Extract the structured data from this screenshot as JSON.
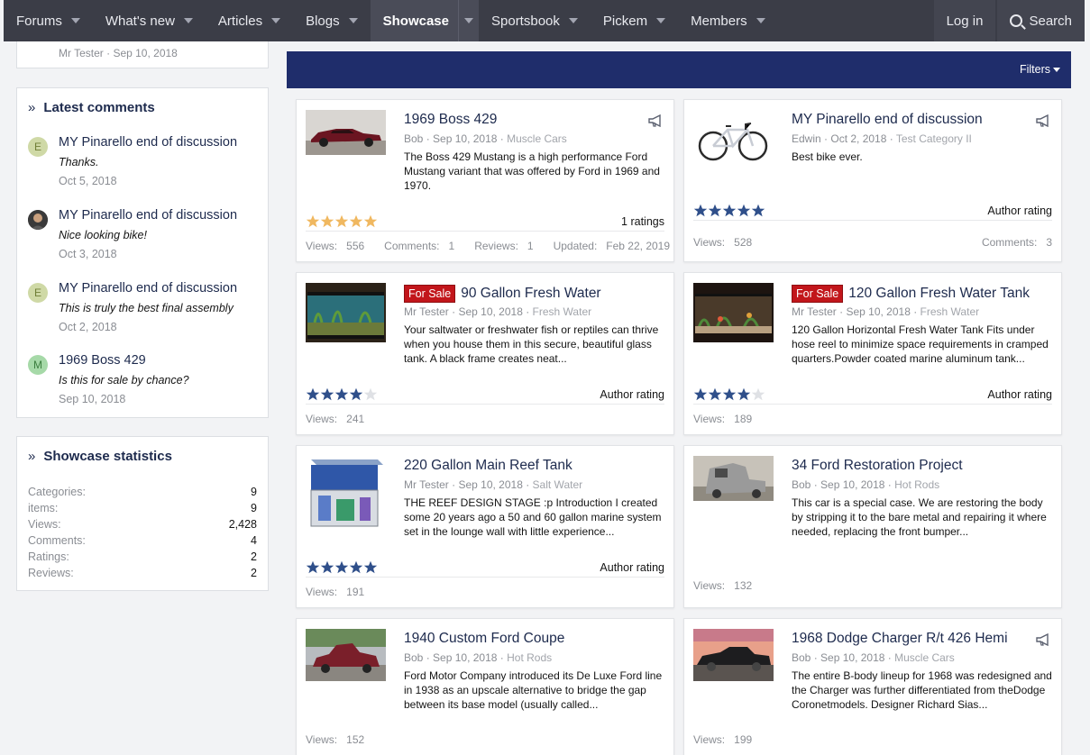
{
  "nav": {
    "items": [
      {
        "label": "Forums"
      },
      {
        "label": "What's new"
      },
      {
        "label": "Articles"
      },
      {
        "label": "Blogs"
      },
      {
        "label": "Showcase"
      },
      {
        "label": "Sportsbook"
      },
      {
        "label": "Pickem"
      },
      {
        "label": "Members"
      }
    ],
    "login": "Log in",
    "search": "Search"
  },
  "sidebar": {
    "top_meta": "Mr Tester · Sep 10, 2018",
    "latest_comments": {
      "title": "Latest comments",
      "items": [
        {
          "avatar": "E",
          "title": "MY Pinarello end of discussion",
          "text": "Thanks.",
          "date": "Oct 5, 2018"
        },
        {
          "avatar": "",
          "title": "MY Pinarello end of discussion",
          "text": "Nice looking bike!",
          "date": "Oct 3, 2018"
        },
        {
          "avatar": "E",
          "title": "MY Pinarello end of discussion",
          "text": "This is truly the best final assembly",
          "date": "Oct 2, 2018"
        },
        {
          "avatar": "M",
          "title": "1969 Boss 429",
          "text": "Is this for sale by chance?",
          "date": "Sep 10, 2018"
        }
      ]
    },
    "stats": {
      "title": "Showcase statistics",
      "rows": [
        {
          "label": "Categories:",
          "value": "9"
        },
        {
          "label": "items:",
          "value": "9"
        },
        {
          "label": "Views:",
          "value": "2,428"
        },
        {
          "label": "Comments:",
          "value": "4"
        },
        {
          "label": "Ratings:",
          "value": "2"
        },
        {
          "label": "Reviews:",
          "value": "2"
        }
      ]
    }
  },
  "filters": "Filters",
  "cards": [
    {
      "title": "1969 Boss 429",
      "badge": "",
      "author": "Bob",
      "date": "Sep 10, 2018",
      "category": "Muscle Cars",
      "desc": "The Boss 429 Mustang is a high performance Ford Mustang variant that was offered by Ford in 1969 and 1970.",
      "rating": 5,
      "rating_label": "1 ratings",
      "views": "556",
      "comments": "1",
      "reviews": "1",
      "updated": "Feb 22, 2019",
      "featured": true
    },
    {
      "title": "MY Pinarello end of discussion",
      "badge": "",
      "author": "Edwin",
      "date": "Oct 2, 2018",
      "category": "Test Category II",
      "desc": "Best bike ever.",
      "rating": 5,
      "rating_label": "Author rating",
      "views": "528",
      "comments": "3",
      "featured": true
    },
    {
      "title": "90 Gallon Fresh Water",
      "badge": "For Sale",
      "author": "Mr Tester",
      "date": "Sep 10, 2018",
      "category": "Fresh Water",
      "desc": "Your saltwater or freshwater fish or reptiles can thrive when you house them in this secure, beautiful glass tank. A black frame creates neat...",
      "rating": 4,
      "rating_label": "Author rating",
      "views": "241"
    },
    {
      "title": "120 Gallon Fresh Water Tank",
      "badge": "For Sale",
      "author": "Mr Tester",
      "date": "Sep 10, 2018",
      "category": "Fresh Water",
      "desc": "120 Gallon Horizontal Fresh Water Tank Fits under hose reel to minimize space requirements in cramped quarters.Powder coated marine aluminum tank...",
      "rating": 4,
      "rating_label": "Author rating",
      "views": "189"
    },
    {
      "title": "220 Gallon Main Reef Tank",
      "badge": "",
      "author": "Mr Tester",
      "date": "Sep 10, 2018",
      "category": "Salt Water",
      "desc": "THE REEF DESIGN STAGE :p Introduction I created some 20 years ago a 50 and 60 gallon marine system set in the lounge wall with little experience...",
      "rating": 5,
      "rating_label": "Author rating",
      "views": "191"
    },
    {
      "title": "34 Ford Restoration Project",
      "badge": "",
      "author": "Bob",
      "date": "Sep 10, 2018",
      "category": "Hot Rods",
      "desc": "This car is a special case. We are restoring the body by stripping it to the bare metal and repairing it where needed, replacing the front bumper...",
      "views": "132"
    },
    {
      "title": "1940 Custom Ford Coupe",
      "badge": "",
      "author": "Bob",
      "date": "Sep 10, 2018",
      "category": "Hot Rods",
      "desc": "Ford Motor Company introduced its De Luxe Ford line in 1938 as an upscale alternative to bridge the gap between its base model (usually called...",
      "views": "152"
    },
    {
      "title": "1968 Dodge Charger R/t 426 Hemi",
      "badge": "",
      "author": "Bob",
      "date": "Sep 10, 2018",
      "category": "Muscle Cars",
      "desc": "The entire B-body lineup for 1968 was redesigned and the Charger was further differentiated from theDodge Coronetmodels. Designer Richard Sias...",
      "views": "199",
      "featured": true
    }
  ],
  "labels": {
    "views": "Views:",
    "comments": "Comments:",
    "reviews": "Reviews:",
    "updated": "Updated:"
  },
  "colors": {
    "nav_bg": "#3b3d47",
    "filter_bar": "#1f2d6b",
    "title": "#1d2a4d",
    "badge": "#c2161b",
    "star_gold": "#f0b860",
    "star_blue": "#2f4f8a"
  }
}
